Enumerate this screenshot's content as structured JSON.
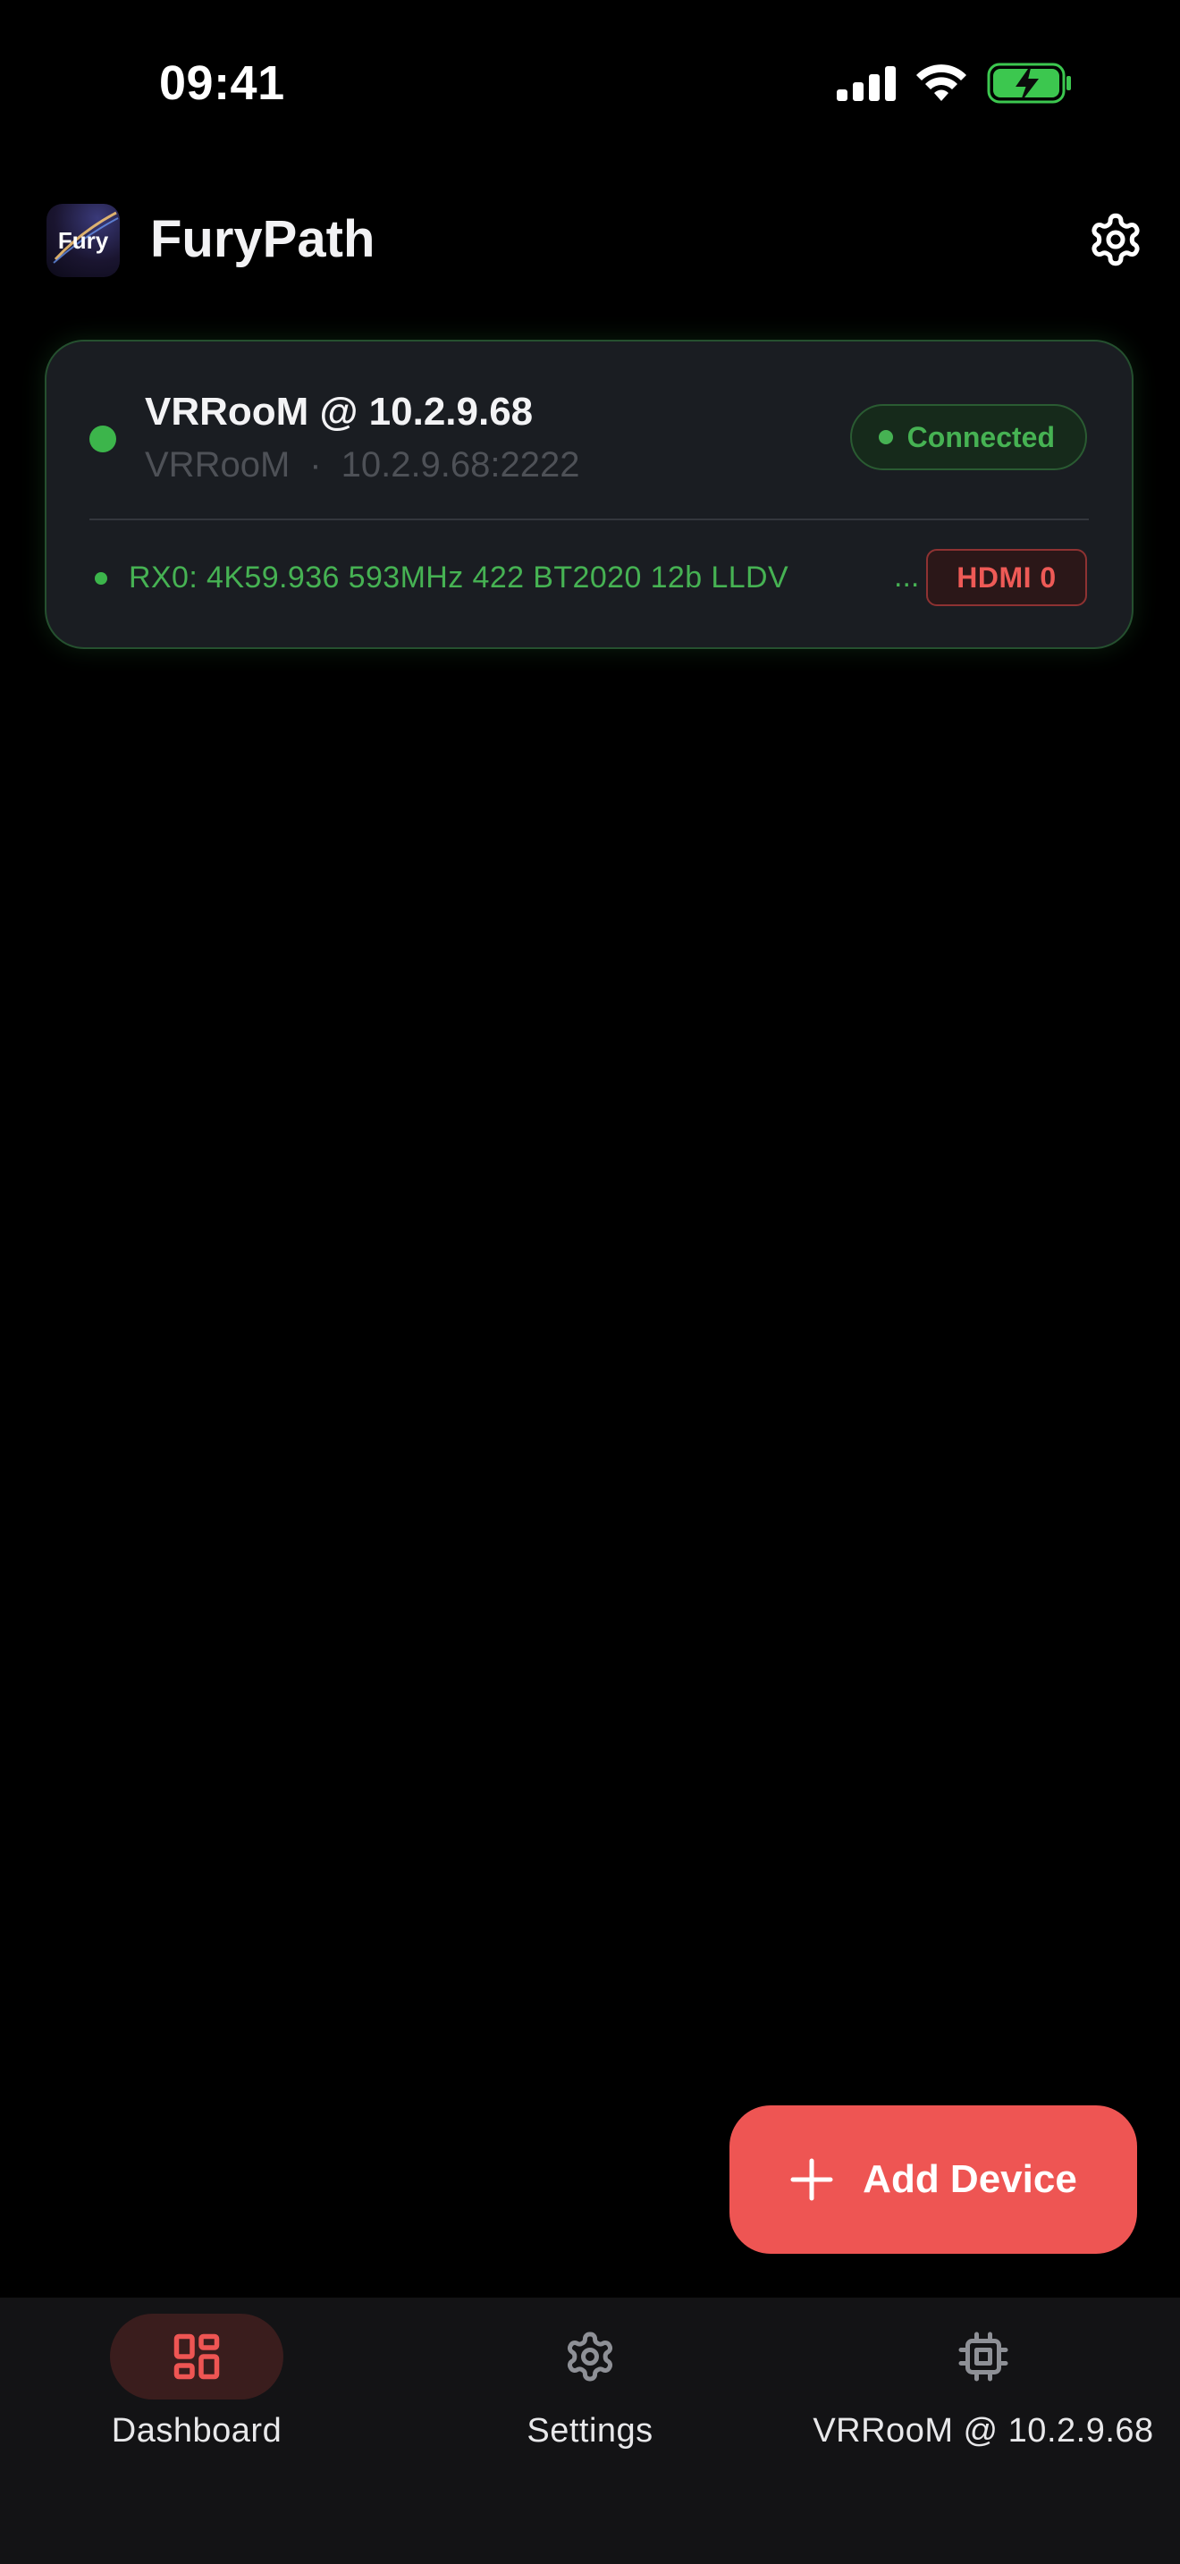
{
  "status_bar": {
    "time": "09:41"
  },
  "app": {
    "logo_text": "Fury",
    "title": "FuryPath"
  },
  "device": {
    "name": "VRRooM @ 10.2.9.68",
    "model": "VRRooM",
    "address": "10.2.9.68:2222",
    "separator": "·",
    "status": "Connected",
    "signal": "RX0: 4K59.936 593MHz 422 BT2020 12b LLDV",
    "ellipsis": "...",
    "input_badge": "HDMI 0"
  },
  "fab": {
    "label": "Add Device"
  },
  "nav": {
    "items": [
      {
        "label": "Dashboard",
        "icon": "dashboard-icon",
        "active": true
      },
      {
        "label": "Settings",
        "icon": "gear-icon",
        "active": false
      },
      {
        "label": "VRRooM @ 10.2.9.68",
        "icon": "chip-icon",
        "active": false
      }
    ]
  },
  "colors": {
    "accent": "#ee5553",
    "connected": "#46b253",
    "card_bg": "#1a1d22",
    "background": "#000000"
  }
}
